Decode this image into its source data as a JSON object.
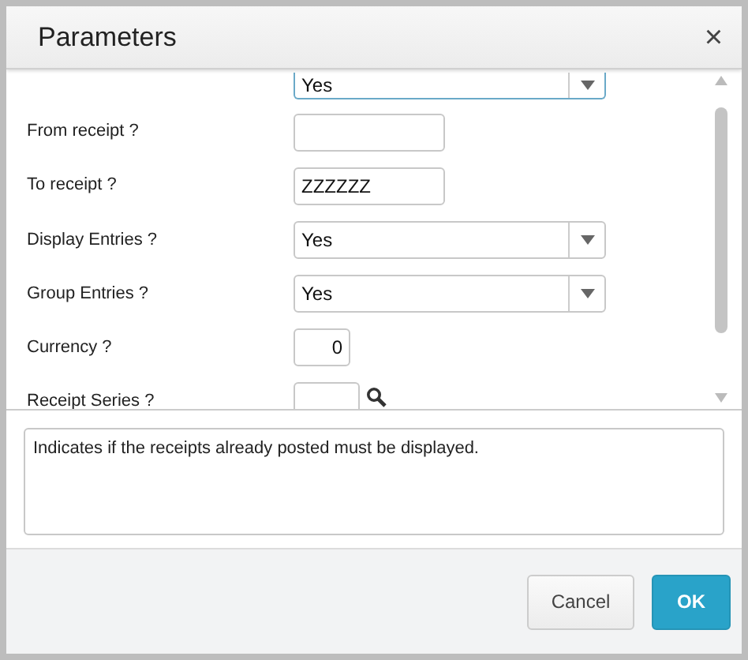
{
  "window": {
    "title": "Parameters",
    "close": "×"
  },
  "fields": [
    {
      "kind": "select",
      "value": "Yes",
      "focused": true
    },
    {
      "kind": "text",
      "label": "From receipt ?"
    },
    {
      "kind": "text",
      "label": "To receipt ?",
      "value": "ZZZZZZ"
    },
    {
      "kind": "select",
      "label": "Display Entries ?",
      "value": "Yes",
      "focused": false
    },
    {
      "kind": "select",
      "label": "Group Entries ?",
      "value": "Yes",
      "focused": false
    },
    {
      "kind": "number",
      "label": "Currency ?",
      "value": "0"
    },
    {
      "kind": "lookup",
      "label": "Receipt Series ?"
    }
  ],
  "description": "Indicates if the receipts already posted must be displayed.",
  "buttons": [
    {
      "label": "Cancel",
      "primary": false
    },
    {
      "label": "OK",
      "primary": true
    }
  ]
}
